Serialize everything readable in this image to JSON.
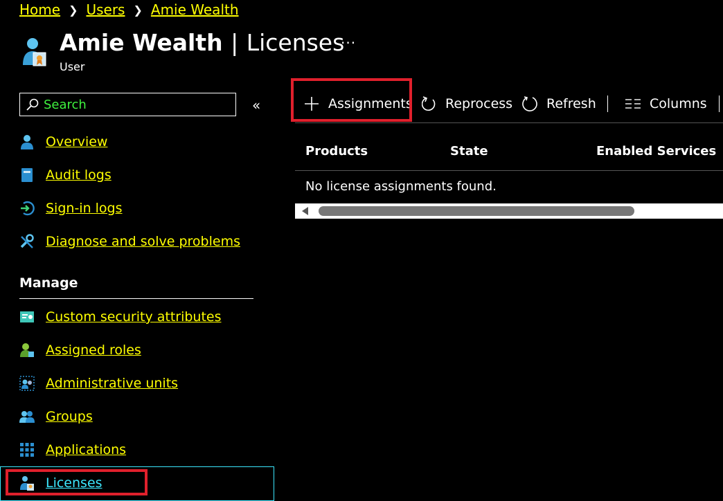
{
  "breadcrumb": {
    "items": [
      "Home",
      "Users",
      "Amie Wealth"
    ]
  },
  "header": {
    "title_name": "Amie Wealth",
    "title_separator": "|",
    "title_section": "Licenses",
    "subtitle": "User",
    "more_label": "···"
  },
  "search": {
    "placeholder": "Search",
    "collapse_label": "«"
  },
  "sidebar": {
    "items": [
      {
        "label": "Overview",
        "icon": "user-icon"
      },
      {
        "label": "Audit logs",
        "icon": "book-icon"
      },
      {
        "label": "Sign-in logs",
        "icon": "sign-in-icon"
      },
      {
        "label": "Diagnose and solve problems",
        "icon": "wrench-icon"
      }
    ],
    "manage_header": "Manage",
    "manage_items": [
      {
        "label": "Custom security attributes",
        "icon": "attributes-icon"
      },
      {
        "label": "Assigned roles",
        "icon": "roles-icon"
      },
      {
        "label": "Administrative units",
        "icon": "admin-units-icon"
      },
      {
        "label": "Groups",
        "icon": "groups-icon"
      },
      {
        "label": "Applications",
        "icon": "apps-grid-icon"
      },
      {
        "label": "Licenses",
        "icon": "license-icon",
        "selected": true
      }
    ]
  },
  "toolbar": {
    "assignments_label": "Assignments",
    "reprocess_label": "Reprocess",
    "refresh_label": "Refresh",
    "columns_label": "Columns"
  },
  "table": {
    "columns": [
      "Products",
      "State",
      "Enabled Services"
    ],
    "empty_message": "No license assignments found."
  },
  "colors": {
    "link": "#ffff00",
    "selected_link": "#3ce8ff",
    "search_text": "#3ff23f",
    "highlight_box": "#e0202c",
    "background": "#000000"
  }
}
